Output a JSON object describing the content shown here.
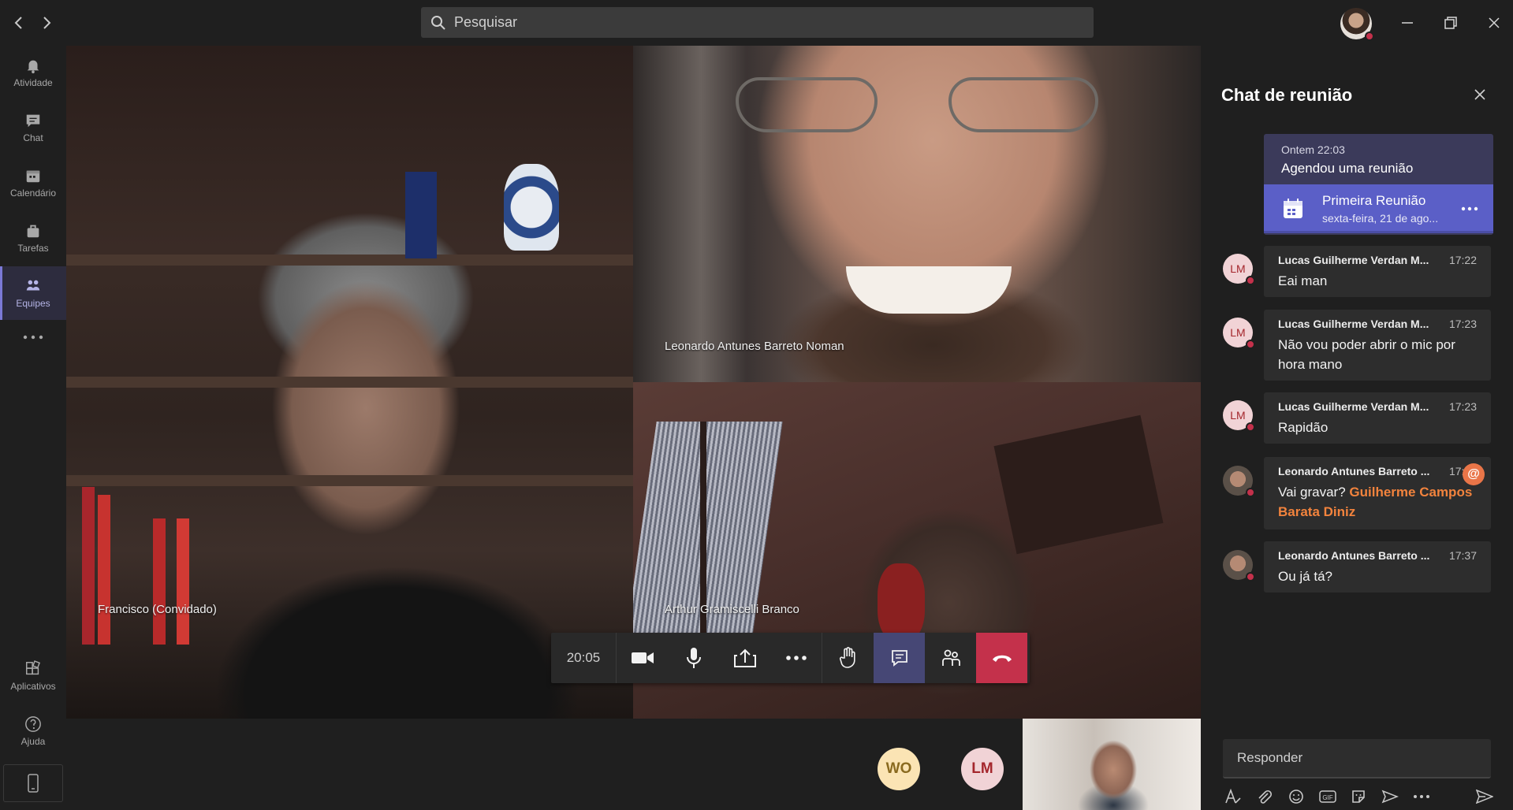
{
  "titlebar": {
    "search_placeholder": "Pesquisar",
    "back_icon": "chevron-left-icon",
    "forward_icon": "chevron-right-icon"
  },
  "rail": {
    "items": [
      {
        "label": "Atividade",
        "icon": "bell-icon"
      },
      {
        "label": "Chat",
        "icon": "chat-icon"
      },
      {
        "label": "Calendário",
        "icon": "calendar-icon"
      },
      {
        "label": "Tarefas",
        "icon": "briefcase-icon"
      },
      {
        "label": "Equipes",
        "icon": "teams-icon",
        "active": true
      }
    ],
    "apps_label": "Aplicativos",
    "help_label": "Ajuda"
  },
  "stage": {
    "tiles": [
      {
        "name": "Francisco (Convidado)"
      },
      {
        "name": "Leonardo Antunes Barreto Noman"
      },
      {
        "name": "Arthur Gramiscelli Branco"
      }
    ],
    "timer": "20:05",
    "participants": [
      {
        "initials": "WO",
        "color": "#fbe4b4",
        "text_color": "#8a6a1f"
      },
      {
        "initials": "LM",
        "color": "#f1d3d6",
        "text_color": "#a4262c"
      }
    ]
  },
  "chat": {
    "title": "Chat de reunião",
    "meeting": {
      "when": "Ontem 22:03",
      "what": "Agendou uma reunião",
      "title": "Primeira Reunião",
      "date": "sexta-feira, 21 de ago..."
    },
    "messages": [
      {
        "sender": "Lucas Guilherme Verdan M...",
        "time": "17:22",
        "body": "Eai man",
        "initials": "LM"
      },
      {
        "sender": "Lucas Guilherme Verdan M...",
        "time": "17:23",
        "body": "Não vou poder abrir o mic por hora mano",
        "initials": "LM"
      },
      {
        "sender": "Lucas Guilherme Verdan M...",
        "time": "17:23",
        "body": "Rapidão",
        "initials": "LM"
      },
      {
        "sender": "Leonardo Antunes Barreto ...",
        "time": "17:37",
        "body_prefix": "Vai gravar? ",
        "mention": "Guilherme Campos Barata Diniz"
      },
      {
        "sender": "Leonardo Antunes Barreto ...",
        "time": "17:37",
        "body": "Ou já tá?"
      }
    ],
    "reply_placeholder": "Responder",
    "mention_badge": "@"
  },
  "colors": {
    "accent": "#5b5fc7",
    "hangup": "#c4314b",
    "presence_busy": "#c4314b",
    "mention": "#f2833d"
  }
}
